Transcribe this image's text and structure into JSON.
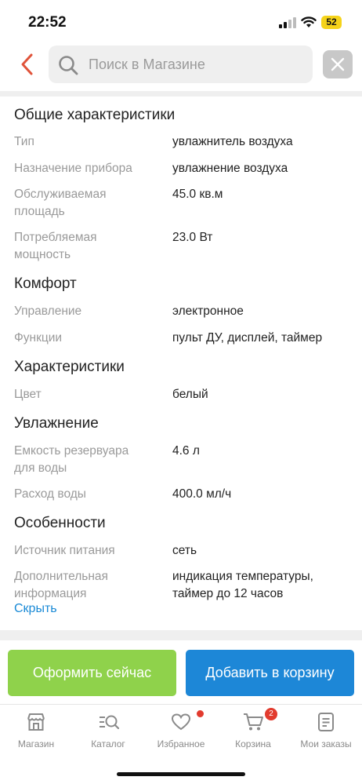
{
  "status_bar": {
    "time": "22:52",
    "battery": "52"
  },
  "search": {
    "placeholder": "Поиск в Магазине"
  },
  "sections": [
    {
      "title": "Общие характеристики"
    },
    {
      "title": "Комфорт"
    },
    {
      "title": "Характеристики"
    },
    {
      "title": "Увлажнение"
    },
    {
      "title": "Особенности"
    }
  ],
  "specs": {
    "type_label": "Тип",
    "type_value": "увлажнитель воздуха",
    "purpose_label": "Назначение прибора",
    "purpose_value": "увлажнение воздуха",
    "area_label_1": "Обслуживаемая",
    "area_label_2": "площадь",
    "area_value": "45.0 кв.м",
    "power_label_1": "Потребляемая",
    "power_label_2": "мощность",
    "power_value": "23.0 Вт",
    "control_label": "Управление",
    "control_value": "электронное",
    "functions_label": "Функции",
    "functions_value": "пульт ДУ, дисплей, таймер",
    "color_label": "Цвет",
    "color_value": "белый",
    "tank_label_1": "Емкость резервуара",
    "tank_label_2": "для воды",
    "tank_value": "4.6 л",
    "flow_label": "Расход воды",
    "flow_value": "400.0 мл/ч",
    "source_label": "Источник питания",
    "source_value": "сеть",
    "extra_label_1": "Дополнительная",
    "extra_label_2": "информация",
    "extra_value_1": "индикация температуры,",
    "extra_value_2": "таймер до 12 часов"
  },
  "hide_link": "Скрыть",
  "buttons": {
    "checkout": "Оформить сейчас",
    "add_to_cart": "Добавить в корзину"
  },
  "tabs": [
    {
      "label": "Магазин",
      "icon": "store-icon"
    },
    {
      "label": "Каталог",
      "icon": "catalog-search-icon"
    },
    {
      "label": "Избранное",
      "icon": "heart-icon"
    },
    {
      "label": "Корзина",
      "icon": "cart-icon",
      "badge": "2"
    },
    {
      "label": "Мои заказы",
      "icon": "orders-icon"
    }
  ],
  "colors": {
    "accent_green": "#8fd24b",
    "accent_blue": "#1d87d7",
    "link": "#1a8ad6",
    "back_arrow": "#e0533a",
    "badge_red": "#e23b2e"
  }
}
